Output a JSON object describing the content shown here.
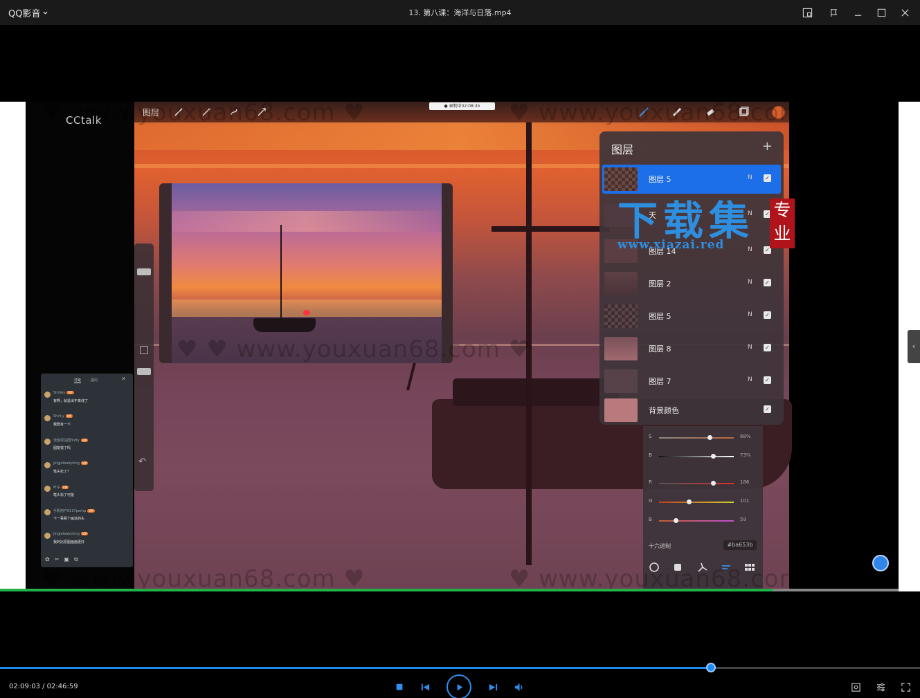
{
  "app": {
    "menu_label": "QQ影音",
    "video_title": "13. 第八课：海洋与日落.mp4"
  },
  "player": {
    "time_current": "02:09:03",
    "time_total": "02:46:59",
    "progress": 0.773
  },
  "video": {
    "cctalk": "CCtalk",
    "app_bar_label": "图层",
    "rec_badge": "● 录制中02:08:45",
    "watermark": "www.youxuan68.com",
    "watermark_brand": "下载集",
    "watermark_brand_url": "www.xiazai.red",
    "watermark_seal": "专业",
    "layers": {
      "title": "图层",
      "items": [
        {
          "name": "图层 5",
          "mode": "N",
          "selected": true
        },
        {
          "name": "天",
          "mode": "N",
          "selected": false
        },
        {
          "name": "图层 14",
          "mode": "N",
          "selected": false
        },
        {
          "name": "图层 2",
          "mode": "N",
          "selected": false
        },
        {
          "name": "图层 5",
          "mode": "N",
          "selected": false
        },
        {
          "name": "图层 8",
          "mode": "N",
          "selected": false
        },
        {
          "name": "图层 7",
          "mode": "N",
          "selected": false
        }
      ],
      "background": "背景颜色"
    },
    "color_panel": {
      "sliders": [
        {
          "label": "S",
          "value": "68%",
          "level": 0.68
        },
        {
          "label": "B",
          "value": "73%",
          "level": 0.73
        },
        {
          "label": "R",
          "value": "186",
          "level": 0.73
        },
        {
          "label": "G",
          "value": "101",
          "level": 0.4
        },
        {
          "label": "B",
          "value": "59",
          "level": 0.23
        }
      ],
      "hex_label": "十六进制",
      "hex_value": "#ba653b"
    },
    "chat": {
      "tabs": [
        "讨论",
        "提问"
      ],
      "messages": [
        {
          "name": "Shirley",
          "text": "有啊，就是出不来线了"
        },
        {
          "name": "Shirl.y",
          "text": "我群有一下"
        },
        {
          "name": "流浪漂泊国fluffy",
          "text": "图能错了吗"
        },
        {
          "name": "jingjelbabyking",
          "text": "笔头松了?"
        },
        {
          "name": "叶子",
          "text": "笔头松了可能"
        },
        {
          "name": "手机用户6117perhp",
          "text": "下一看看个画这的头"
        },
        {
          "name": "jingjelbabyking",
          "text": "我的比原图画面更好"
        }
      ]
    }
  },
  "colors": {
    "accent": "#1e8bf0",
    "selected_layer": "#1c6fe8",
    "titlebar": "#1a1a1a"
  }
}
